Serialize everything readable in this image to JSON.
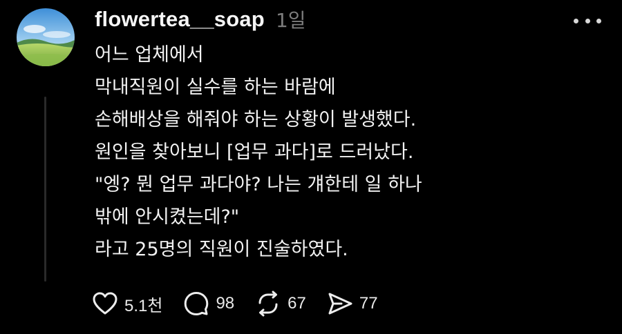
{
  "post": {
    "username": "flowertea__soap",
    "timestamp": "1일",
    "lines": [
      "어느 업체에서",
      "막내직원이 실수를 하는 바람에",
      "손해배상을 해줘야 하는 상황이 발생했다.",
      "원인을 찾아보니 [업무 과다]로 드러났다.",
      "\"엥? 뭔 업무 과다야? 나는 걔한테 일 하나",
      "밖에 안시켰는데?\"",
      "라고 25명의 직원이 진술하였다."
    ],
    "actions": [
      {
        "icon": "heart-icon",
        "count": "5.1천"
      },
      {
        "icon": "comment-bubble-icon",
        "count": "98"
      },
      {
        "icon": "repost-icon",
        "count": "67"
      },
      {
        "icon": "share-send-icon",
        "count": "77"
      }
    ],
    "more_icon": "more-dots-icon",
    "avatar_icon": "landscape-avatar"
  },
  "colors": {
    "background": "#000000",
    "text": "#f2f2f2",
    "muted": "#7d7d7d",
    "thread_line": "#2a2a2a"
  }
}
